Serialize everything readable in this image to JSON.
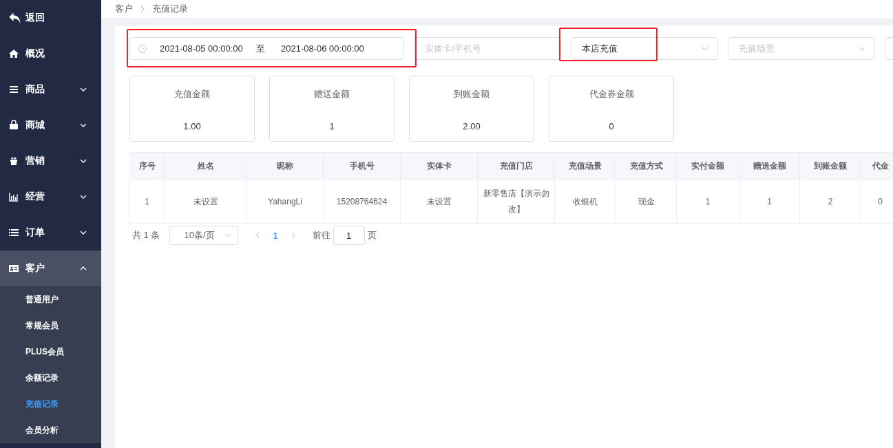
{
  "sidebar": {
    "items": [
      {
        "label": "返回",
        "kind": "back"
      },
      {
        "label": "概况",
        "kind": "home"
      },
      {
        "label": "商品",
        "kind": "lines",
        "expanded": false
      },
      {
        "label": "商城",
        "kind": "bag",
        "expanded": false
      },
      {
        "label": "营销",
        "kind": "gift",
        "expanded": false
      },
      {
        "label": "经营",
        "kind": "chart",
        "expanded": false
      },
      {
        "label": "订单",
        "kind": "list",
        "expanded": false
      },
      {
        "label": "客户",
        "kind": "card",
        "expanded": true,
        "children": [
          {
            "label": "普通用户",
            "selected": false
          },
          {
            "label": "常规会员",
            "selected": false
          },
          {
            "label": "PLUS会员",
            "selected": false
          },
          {
            "label": "余额记录",
            "selected": false
          },
          {
            "label": "充值记录",
            "selected": true
          },
          {
            "label": "会员分析",
            "selected": false
          }
        ]
      }
    ]
  },
  "breadcrumb": [
    "客户",
    "充值记录"
  ],
  "filters": {
    "start_date": "2021-08-05 00:00:00",
    "separator": "至",
    "end_date": "2021-08-06 00:00:00",
    "card_phone": {
      "placeholder": "实体卡/手机号"
    },
    "source": {
      "value": "本店充值"
    },
    "scene": {
      "placeholder": "充值场景"
    }
  },
  "summary": [
    {
      "label": "充值金额",
      "value": "1.00"
    },
    {
      "label": "赠送金额",
      "value": "1"
    },
    {
      "label": "到账金额",
      "value": "2.00"
    },
    {
      "label": "代金券金额",
      "value": "0"
    }
  ],
  "table": {
    "columns": [
      "序号",
      "姓名",
      "昵称",
      "手机号",
      "实体卡",
      "充值门店",
      "充值场景",
      "充值方式",
      "实付金额",
      "赠送金额",
      "到账金额",
      "代金"
    ],
    "rows": [
      [
        "1",
        "未设置",
        "YahangLi",
        "15208764624",
        "未设置",
        "新零售店【演示勿改】",
        "收银机",
        "现金",
        "1",
        "1",
        "2",
        "0"
      ]
    ]
  },
  "pagination": {
    "total": "共 1 条",
    "page_size": "10条/页",
    "pages": [
      {
        "label": "1",
        "selected": true
      }
    ],
    "goto_label": "前往",
    "goto_value": "1",
    "page_suffix": "页"
  }
}
